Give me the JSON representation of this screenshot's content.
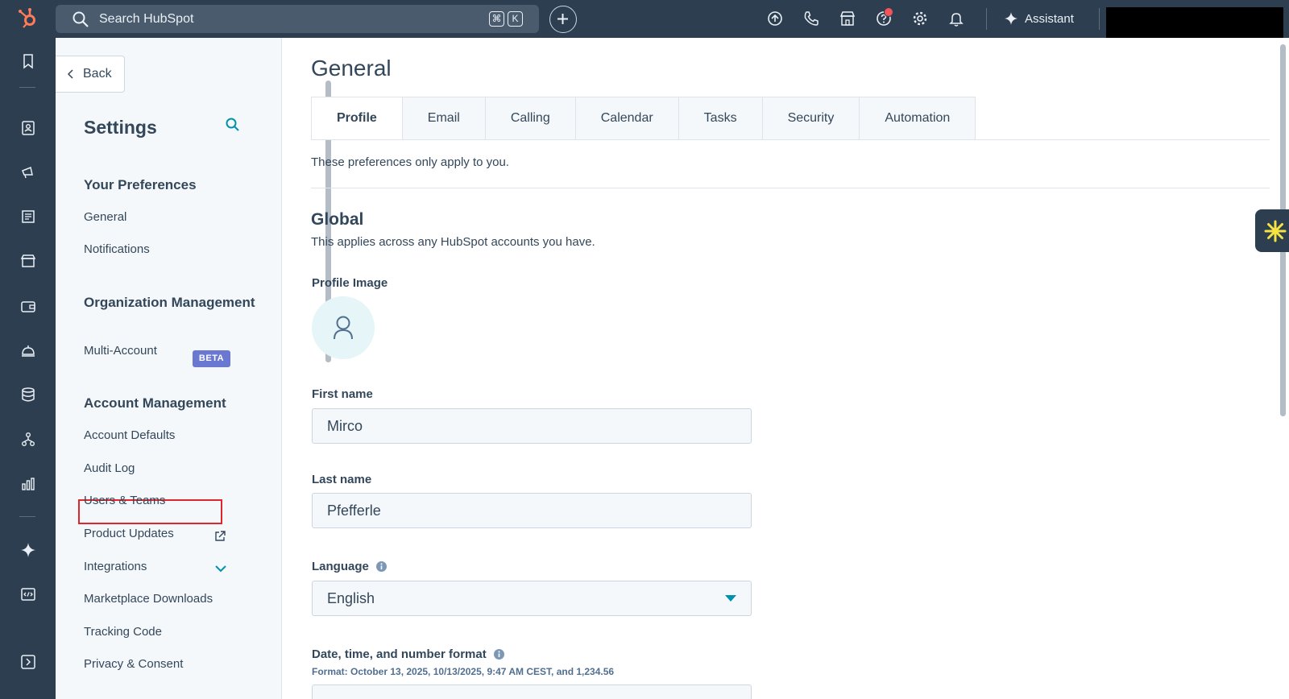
{
  "topbar": {
    "search_placeholder": "Search HubSpot",
    "shortcut_key_1": "⌘",
    "shortcut_key_2": "K",
    "assistant_label": "Assistant"
  },
  "sidebar": {
    "back_label": "Back",
    "title": "Settings",
    "groups": [
      {
        "title": "Your Preferences",
        "items": [
          "General",
          "Notifications"
        ]
      },
      {
        "title": "Organization Management",
        "items": [
          "Multi-Account"
        ]
      },
      {
        "title": "Account Management",
        "items": [
          "Account Defaults",
          "Audit Log",
          "Users & Teams",
          "Product Updates",
          "Integrations",
          "Marketplace Downloads",
          "Tracking Code",
          "Privacy & Consent"
        ]
      }
    ],
    "beta_badge": "BETA"
  },
  "main": {
    "title": "General",
    "tabs": [
      "Profile",
      "Email",
      "Calling",
      "Calendar",
      "Tasks",
      "Security",
      "Automation"
    ],
    "pref_note": "These preferences only apply to you.",
    "global_title": "Global",
    "global_sub": "This applies across any HubSpot accounts you have.",
    "profile_image_label": "Profile Image",
    "first_name_label": "First name",
    "first_name_value": "Mirco",
    "last_name_label": "Last name",
    "last_name_value": "Pfefferle",
    "language_label": "Language",
    "language_value": "English",
    "date_format_label": "Date, time, and number format",
    "format_note": "Format: October 13, 2025, 10/13/2025, 9:47 AM CEST, and 1,234.56"
  },
  "colors": {
    "topbar_bg": "#2d3e50",
    "accent_orange": "#ff7a59",
    "link_teal": "#0091ae",
    "beta_badge": "#6a78d1",
    "highlight_red": "#e0252b"
  }
}
